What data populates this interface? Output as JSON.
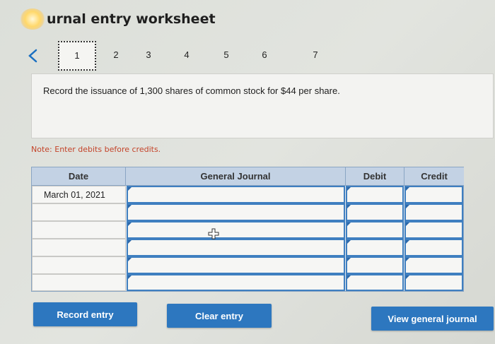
{
  "header": {
    "title": "urnal entry worksheet"
  },
  "stepper": {
    "steps": [
      "1",
      "2",
      "3",
      "4",
      "5",
      "6",
      "7"
    ],
    "active_index": 0
  },
  "question": {
    "text": "Record the issuance of 1,300 shares of common stock for $44 per share."
  },
  "note": "Note: Enter debits before credits.",
  "journal": {
    "columns": {
      "date": "Date",
      "general_journal": "General Journal",
      "debit": "Debit",
      "credit": "Credit"
    },
    "rows": [
      {
        "date": "March 01, 2021",
        "account": "",
        "debit": "",
        "credit": ""
      },
      {
        "date": "",
        "account": "",
        "debit": "",
        "credit": ""
      },
      {
        "date": "",
        "account": "",
        "debit": "",
        "credit": ""
      },
      {
        "date": "",
        "account": "",
        "debit": "",
        "credit": ""
      },
      {
        "date": "",
        "account": "",
        "debit": "",
        "credit": ""
      },
      {
        "date": "",
        "account": "",
        "debit": "",
        "credit": ""
      }
    ]
  },
  "buttons": {
    "record": "Record entry",
    "clear": "Clear entry",
    "view": "View general journal"
  },
  "colors": {
    "button": "#2d77bf",
    "header_fill": "#c3d2e4",
    "input_border": "#3f7fc0",
    "note_text": "#c4442a",
    "nav_arrow": "#1a6fc1"
  },
  "icons": {
    "prev": "chevron-left-icon",
    "cursor": "move-cursor-icon"
  }
}
